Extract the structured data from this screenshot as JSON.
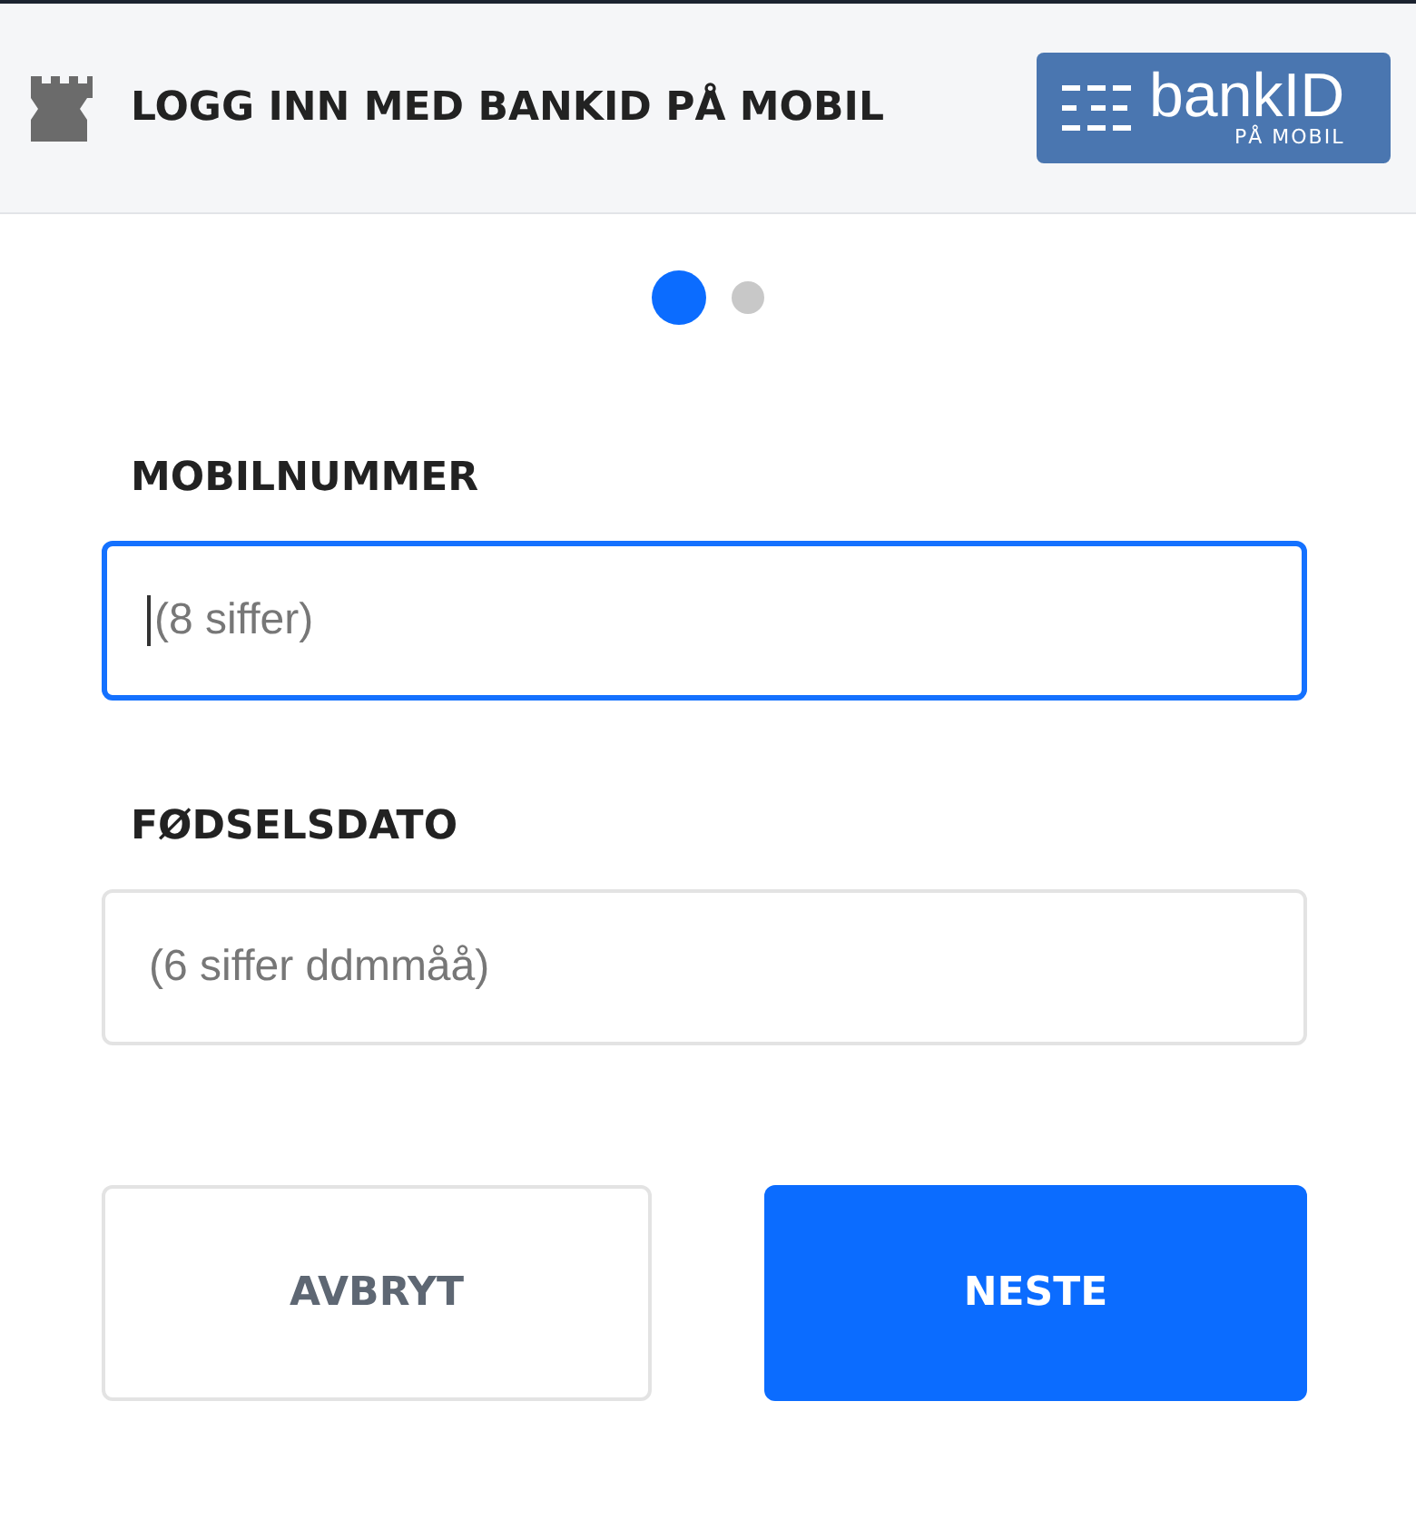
{
  "header": {
    "title": "LOGG INN MED BANKID PÅ MOBIL",
    "logo": {
      "wordmark": "bankID",
      "subtitle": "PÅ MOBIL"
    }
  },
  "steps": [
    {
      "selected": true
    },
    {
      "selected": false
    }
  ],
  "fields": [
    {
      "label": "MOBILNUMMER",
      "placeholder": "(8 siffer)",
      "focused": true
    },
    {
      "label": "FØDSELSDATO",
      "placeholder": "(6 siffer ddmmåå)",
      "focused": false
    }
  ],
  "buttons": [
    {
      "label": "AVBRYT",
      "kind": "secondary"
    },
    {
      "label": "NESTE",
      "kind": "primary"
    }
  ]
}
